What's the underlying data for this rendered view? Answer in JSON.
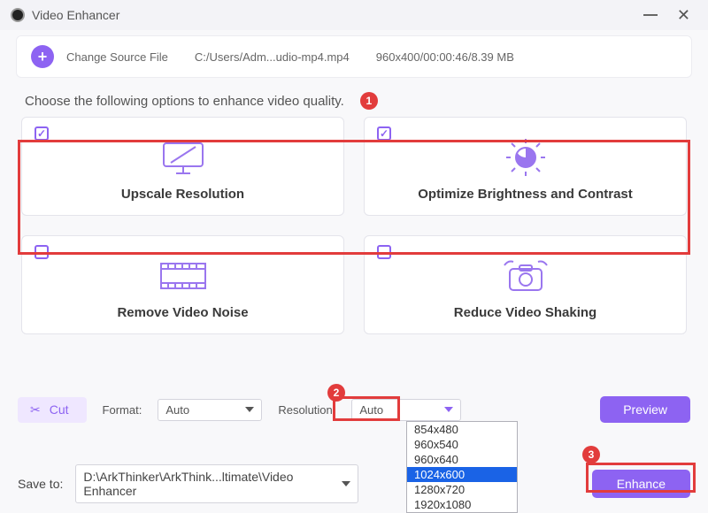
{
  "window": {
    "title": "Video Enhancer"
  },
  "filebar": {
    "change_label": "Change Source File",
    "path": "C:/Users/Adm...udio-mp4.mp4",
    "meta": "960x400/00:00:46/8.39 MB"
  },
  "instruction": "Choose the following options to enhance video quality.",
  "steps": {
    "s1": "1",
    "s2": "2",
    "s3": "3"
  },
  "cards": {
    "upscale": {
      "label": "Upscale Resolution",
      "checked": true
    },
    "bright": {
      "label": "Optimize Brightness and Contrast",
      "checked": true
    },
    "noise": {
      "label": "Remove Video Noise",
      "checked": false
    },
    "shake": {
      "label": "Reduce Video Shaking",
      "checked": false
    }
  },
  "controls": {
    "cut_label": "Cut",
    "format_label": "Format:",
    "format_value": "Auto",
    "resolution_label": "Resolution:",
    "resolution_value": "Auto",
    "preview_label": "Preview"
  },
  "resolution_options": [
    "854x480",
    "960x540",
    "960x640",
    "1024x600",
    "1280x720",
    "1920x1080"
  ],
  "resolution_selected": "1024x600",
  "save": {
    "label": "Save to:",
    "path": "D:\\ArkThinker\\ArkThink...ltimate\\Video Enhancer"
  },
  "enhance_label": "Enhance"
}
